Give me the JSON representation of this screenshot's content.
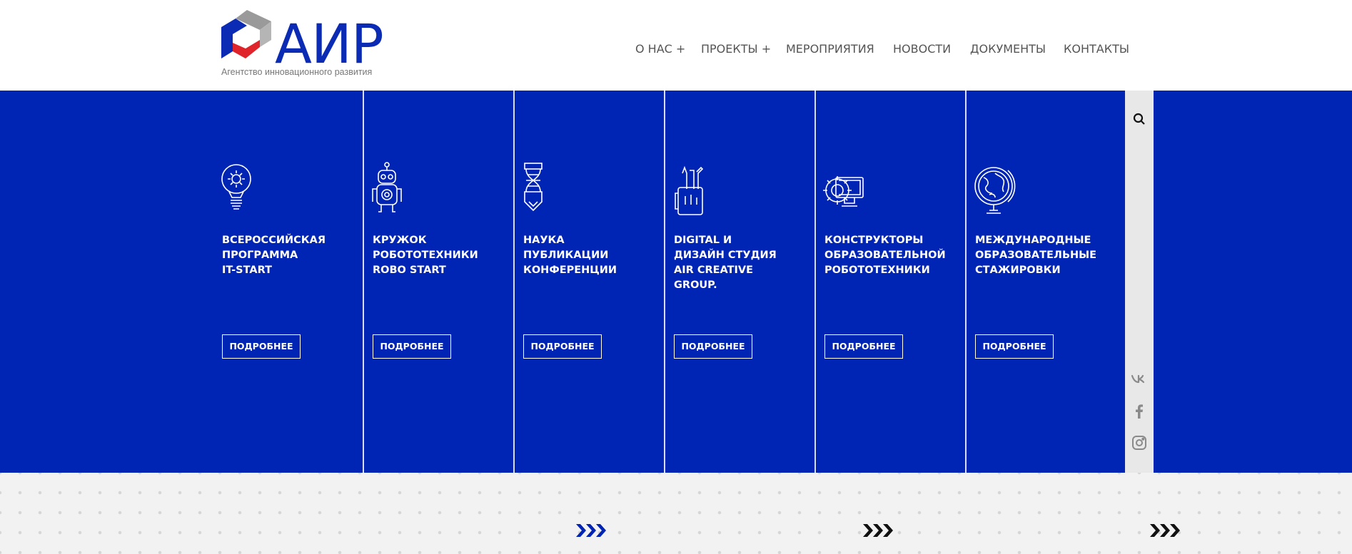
{
  "logo": {
    "word": "АИР",
    "subtitle": "Агентство инновационного развития",
    "colors": {
      "blue": "#0b2bb5",
      "red": "#e0242c",
      "grey": "#9a9a9a"
    }
  },
  "nav": {
    "items": [
      {
        "label": "О НАС +"
      },
      {
        "label": "ПРОЕКТЫ +"
      },
      {
        "label": "МЕРОПРИЯТИЯ"
      },
      {
        "label": "НОВОСТИ"
      },
      {
        "label": "ДОКУМЕНТЫ"
      },
      {
        "label": "КОНТАКТЫ"
      }
    ]
  },
  "hero": {
    "background": "#0024b4",
    "columns": [
      {
        "icon": "lightbulb-gear-icon",
        "title": "ВСЕРОССИЙСКАЯ\nПРОГРАММА\nIT-START",
        "button": "ПОДРОБНЕЕ"
      },
      {
        "icon": "robot-icon",
        "title": "КРУЖОК\nРОБОТОТЕХНИКИ\nROBO START",
        "button": "ПОДРОБНЕЕ"
      },
      {
        "icon": "dna-pencil-icon",
        "title": "НАУКА\nПУБЛИКАЦИИ\nКОНФЕРЕНЦИИ",
        "button": "ПОДРОБНЕЕ"
      },
      {
        "icon": "pencil-cup-icon",
        "title": "DIGITAL И\nДИЗАЙН СТУДИЯ\nAIR CREATIVE\nGROUP.",
        "button": "ПОДРОБНЕЕ"
      },
      {
        "icon": "gear-monitor-icon",
        "title": "КОНСТРУКТОРЫ\nОБРАЗОВАТЕЛЬНОЙ\nРОБОТОТЕХНИКИ",
        "button": "ПОДРОБНЕЕ"
      },
      {
        "icon": "globe-icon",
        "title": "МЕЖДУНАРОДНЫЕ\nОБРАЗОВАТЕЛЬНЫЕ\nСТАЖИРОВКИ",
        "button": "ПОДРОБНЕЕ"
      }
    ]
  },
  "sidebar": {
    "icons": [
      "search-icon",
      "vk-icon",
      "facebook-icon",
      "instagram-icon"
    ]
  },
  "bottom": {
    "arrow_colors": [
      "#0024b4",
      "#111111",
      "#111111"
    ]
  }
}
